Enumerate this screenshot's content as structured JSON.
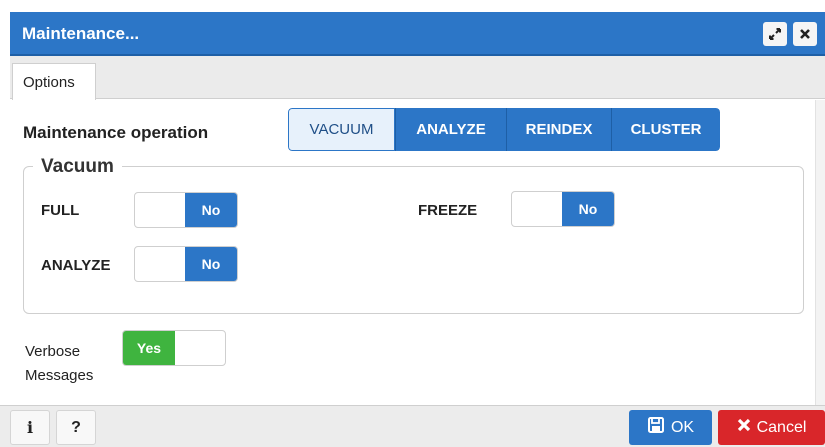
{
  "dialog": {
    "title": "Maintenance...",
    "tabs": [
      {
        "label": "Options",
        "active": true
      }
    ]
  },
  "operation": {
    "label": "Maintenance operation",
    "options": [
      "VACUUM",
      "ANALYZE",
      "REINDEX",
      "CLUSTER"
    ],
    "selected": "VACUUM"
  },
  "vacuum": {
    "legend": "Vacuum",
    "full": {
      "label": "FULL",
      "value": "No"
    },
    "freeze": {
      "label": "FREEZE",
      "value": "No"
    },
    "analyze": {
      "label": "ANALYZE",
      "value": "No"
    }
  },
  "verbose": {
    "label_line1": "Verbose",
    "label_line2": "Messages",
    "value": "Yes"
  },
  "footer": {
    "info_label": "i",
    "help_label": "?",
    "ok_label": "OK",
    "cancel_label": "Cancel"
  },
  "colors": {
    "accent": "#2c76c7",
    "toggle_on": "#3fb43f",
    "cancel": "#d9262a"
  },
  "icons": {
    "expand": "expand-icon",
    "close": "close-icon",
    "ok": "save-icon",
    "cancel": "x-icon"
  }
}
